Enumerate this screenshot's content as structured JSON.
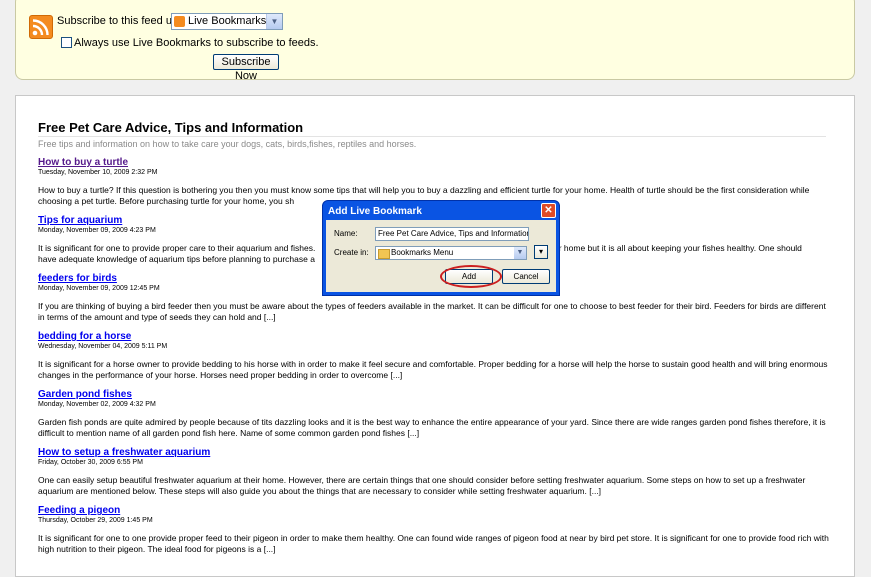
{
  "subscribe": {
    "label": "Subscribe to this feed using",
    "reader_selected": "Live Bookmarks",
    "always_use_label": "Always use Live Bookmarks to subscribe to feeds.",
    "always_use_checked": false,
    "button_label": "Subscribe Now"
  },
  "feed": {
    "title": "Free Pet Care Advice, Tips and Information",
    "subtitle": "Free tips and information on how to take care your dogs, cats, birds,fishes, reptiles and horses.",
    "entries": [
      {
        "title": "How to buy a turtle",
        "date": "Tuesday, November 10, 2009 2:32 PM",
        "visited": true,
        "text": "How to buy a turtle? If this question is bothering you then you must know some tips that will help you to buy a dazzling and efficient turtle for your home. Health of turtle should be the first consideration while choosing a pet turtle. Before purchasing turtle for your home, you sh"
      },
      {
        "title": "Tips for aquarium",
        "date": "Monday, November 09, 2009 4:23 PM",
        "visited": false,
        "text_left": "It is significant for one to provide proper care to their aquarium and fishes.",
        "text_right": "ur home but it is all about keeping your fishes healthy. One should",
        "text_line2": "have adequate knowledge of aquarium tips before planning to purchase a"
      },
      {
        "title": "feeders for birds",
        "date": "Monday, November 09, 2009 12:45 PM",
        "visited": false,
        "text": "If you are thinking of buying a bird feeder then you must be aware about the types of feeders available in the market. It can be difficult for one to choose to best feeder for their bird. Feeders for birds are different in terms of the amount and type of seeds they can hold and [...]"
      },
      {
        "title": "bedding for a horse",
        "date": "Wednesday, November 04, 2009 5:11 PM",
        "visited": false,
        "text": "It is significant for a horse owner to provide bedding to his horse with in order to make it feel secure and comfortable. Proper bedding for a horse will help the horse to sustain good health and will bring enormous changes in the performance of your horse. Horses need proper bedding in order to overcome [...]"
      },
      {
        "title": "Garden pond fishes",
        "date": "Monday, November 02, 2009 4:32 PM",
        "visited": false,
        "text": "Garden fish ponds are quite admired by people because of tits dazzling looks and it is the best way to enhance the entire appearance of your yard. Since there are wide ranges garden pond fishes therefore, it is difficult to mention name of all garden pond fish here. Name of some common garden pond fishes [...]"
      },
      {
        "title": "How to setup a freshwater aquarium",
        "date": "Friday, October 30, 2009 6:55 PM",
        "visited": false,
        "text": "One can easily setup beautiful freshwater aquarium at their home. However, there are certain things that one should consider before setting freshwater aquarium. Some steps on how to set up a freshwater aquarium are mentioned below. These steps will also guide you about the things that are necessary to consider while setting freshwater aquarium. [...]"
      },
      {
        "title": "Feeding a pigeon",
        "date": "Thursday, October 29, 2009 1:45 PM",
        "visited": false,
        "text": "It is significant for one to one provide proper feed to their pigeon in order to make them healthy. One can found wide ranges of pigeon food at near by bird pet store. It is significant for one to provide food rich with high nutrition to their pigeon. The ideal food for pigeons is a [...]"
      }
    ]
  },
  "dialog": {
    "title": "Add Live Bookmark",
    "name_label": "Name:",
    "name_value": "Free Pet Care Advice, Tips and Information",
    "create_in_label": "Create in:",
    "create_in_value": "Bookmarks Menu",
    "add_label": "Add",
    "cancel_label": "Cancel",
    "close_glyph": "✕",
    "expand_glyph": "▾",
    "dropdown_glyph": "▼"
  },
  "colors": {
    "link": "#0000ee",
    "visited_link": "#551a8b",
    "subscribe_panel_bg": "#ffffe1",
    "dialog_titlebar": "#0a54e3",
    "highlight_oval": "#cc1f1f"
  }
}
